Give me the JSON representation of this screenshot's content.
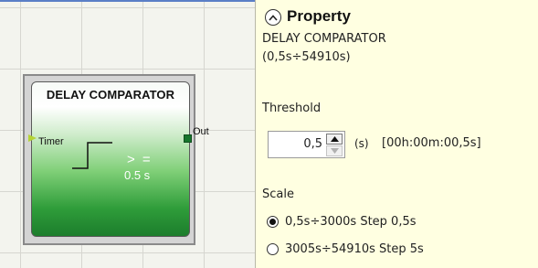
{
  "block": {
    "title": "DELAY COMPARATOR",
    "input_label": "Timer",
    "output_label": "Out",
    "operator": "> =",
    "value": "0.5 s"
  },
  "property": {
    "title": "Property",
    "component_name": "DELAY COMPARATOR",
    "range": "(0,5s÷54910s)",
    "threshold_label": "Threshold",
    "threshold_value": "0,5",
    "unit": "(s)",
    "time_format": "[00h:00m:00,5s]",
    "scale_label": "Scale",
    "scale_options": [
      {
        "label": "0,5s÷3000s Step 0,5s",
        "checked": true
      },
      {
        "label": "3005s÷54910s Step 5s",
        "checked": false
      }
    ]
  },
  "icons": {
    "collapse": "chevron-up-circle-icon",
    "spin_up": "triangle-up-icon",
    "spin_down": "triangle-down-icon",
    "step": "step-signal-icon"
  },
  "colors": {
    "panel_background": "#ffffe1",
    "block_green": "#2f9d3a",
    "input_port": "#b5d334",
    "output_port": "#16752c"
  }
}
